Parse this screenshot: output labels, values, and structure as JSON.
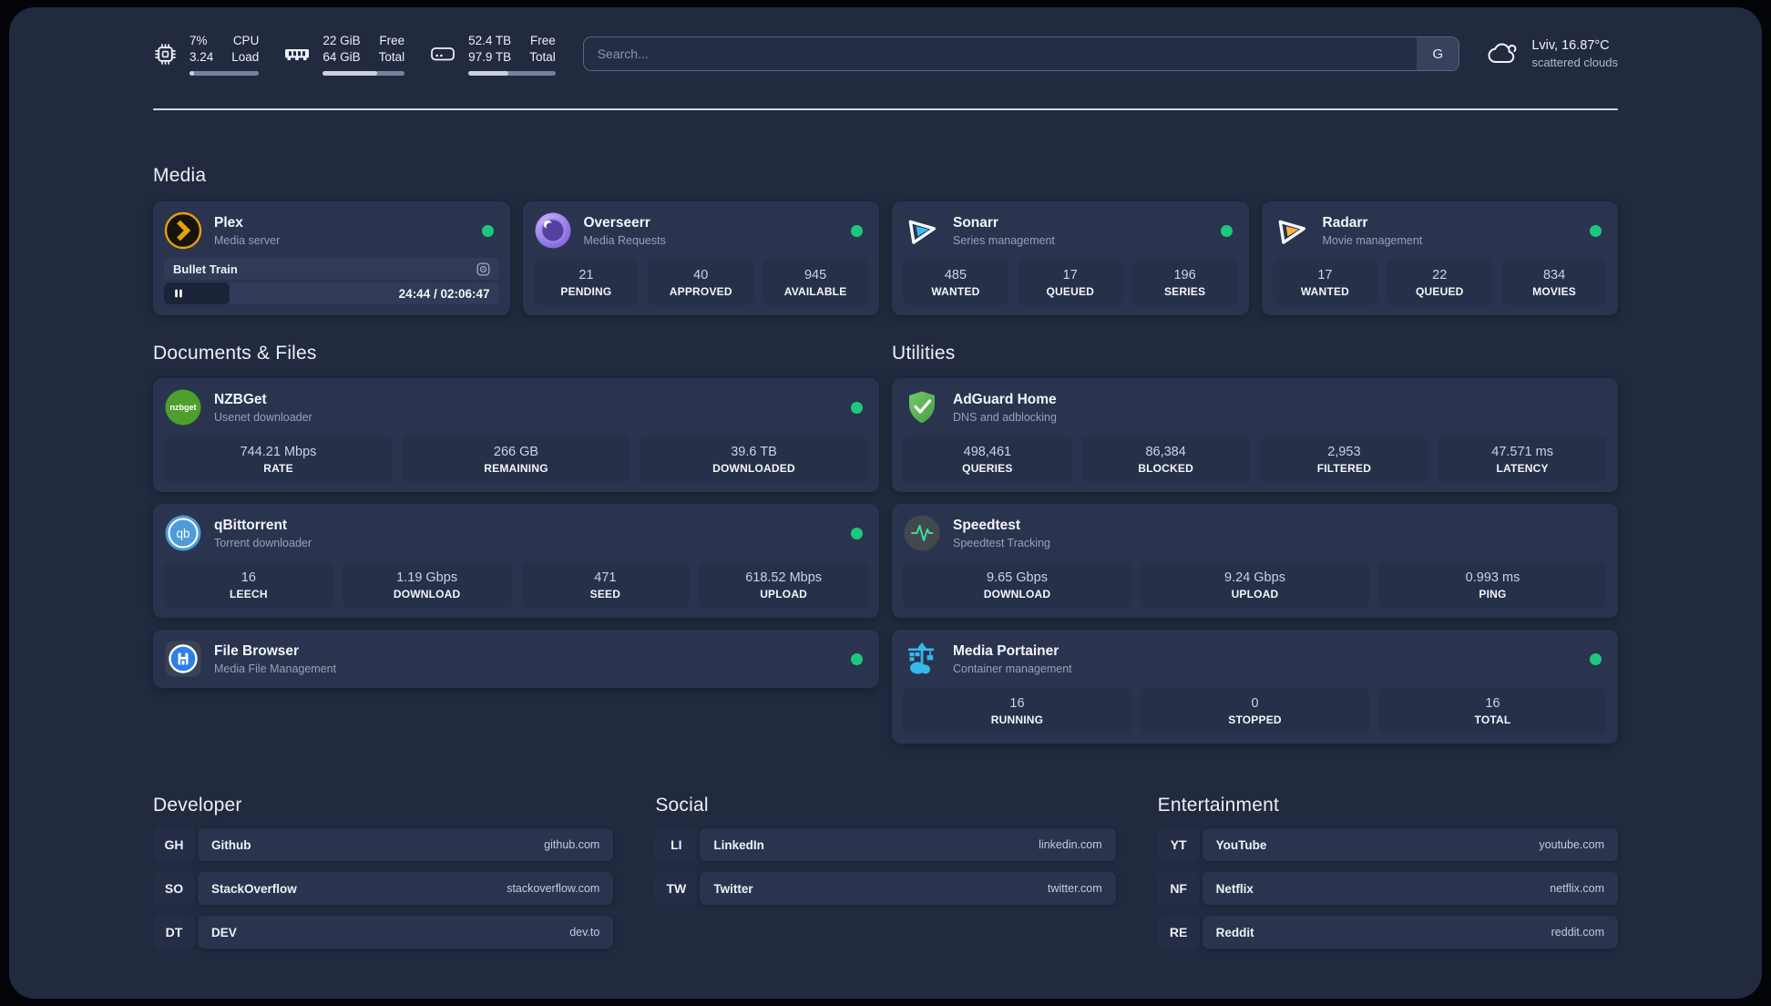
{
  "topbar": {
    "cpu": {
      "value_top": "7%",
      "value_bottom": "3.24",
      "label_top": "CPU",
      "label_bottom": "Load",
      "progress_pct": 7
    },
    "memory": {
      "value_top": "22 GiB",
      "value_bottom": "64 GiB",
      "label_top": "Free",
      "label_bottom": "Total",
      "progress_pct": 66
    },
    "storage": {
      "value_top": "52.4 TB",
      "value_bottom": "97.9 TB",
      "label_top": "Free",
      "label_bottom": "Total",
      "progress_pct": 46
    },
    "search": {
      "placeholder": "Search...",
      "button": "G"
    },
    "weather": {
      "location": "Lviv, 16.87°C",
      "condition": "scattered clouds"
    }
  },
  "sections": {
    "media": "Media",
    "documents": "Documents & Files",
    "utilities": "Utilities"
  },
  "apps": {
    "plex": {
      "name": "Plex",
      "subtitle": "Media server",
      "status": "online",
      "now_playing": {
        "title": "Bullet Train",
        "time": "24:44 / 02:06:47",
        "progress_pct": 19.5
      }
    },
    "overseerr": {
      "name": "Overseerr",
      "subtitle": "Media Requests",
      "status": "online",
      "stats": [
        {
          "value": "21",
          "label": "PENDING"
        },
        {
          "value": "40",
          "label": "APPROVED"
        },
        {
          "value": "945",
          "label": "AVAILABLE"
        }
      ]
    },
    "sonarr": {
      "name": "Sonarr",
      "subtitle": "Series management",
      "status": "online",
      "stats": [
        {
          "value": "485",
          "label": "WANTED"
        },
        {
          "value": "17",
          "label": "QUEUED"
        },
        {
          "value": "196",
          "label": "SERIES"
        }
      ]
    },
    "radarr": {
      "name": "Radarr",
      "subtitle": "Movie management",
      "status": "online",
      "stats": [
        {
          "value": "17",
          "label": "WANTED"
        },
        {
          "value": "22",
          "label": "QUEUED"
        },
        {
          "value": "834",
          "label": "MOVIES"
        }
      ]
    },
    "nzbget": {
      "name": "NZBGet",
      "subtitle": "Usenet downloader",
      "status": "online",
      "stats": [
        {
          "value": "744.21 Mbps",
          "label": "RATE"
        },
        {
          "value": "266 GB",
          "label": "REMAINING"
        },
        {
          "value": "39.6 TB",
          "label": "DOWNLOADED"
        }
      ]
    },
    "qbittorrent": {
      "name": "qBittorrent",
      "subtitle": "Torrent downloader",
      "status": "online",
      "stats": [
        {
          "value": "16",
          "label": "LEECH"
        },
        {
          "value": "1.19 Gbps",
          "label": "DOWNLOAD"
        },
        {
          "value": "471",
          "label": "SEED"
        },
        {
          "value": "618.52 Mbps",
          "label": "UPLOAD"
        }
      ]
    },
    "filebrowser": {
      "name": "File Browser",
      "subtitle": "Media File Management",
      "status": "online"
    },
    "adguard": {
      "name": "AdGuard Home",
      "subtitle": "DNS and adblocking",
      "stats": [
        {
          "value": "498,461",
          "label": "QUERIES"
        },
        {
          "value": "86,384",
          "label": "BLOCKED"
        },
        {
          "value": "2,953",
          "label": "FILTERED"
        },
        {
          "value": "47.571 ms",
          "label": "LATENCY"
        }
      ]
    },
    "speedtest": {
      "name": "Speedtest",
      "subtitle": "Speedtest Tracking",
      "stats": [
        {
          "value": "9.65 Gbps",
          "label": "DOWNLOAD"
        },
        {
          "value": "9.24 Gbps",
          "label": "UPLOAD"
        },
        {
          "value": "0.993 ms",
          "label": "PING"
        }
      ]
    },
    "portainer": {
      "name": "Media Portainer",
      "subtitle": "Container management",
      "status": "online",
      "stats": [
        {
          "value": "16",
          "label": "RUNNING"
        },
        {
          "value": "0",
          "label": "STOPPED"
        },
        {
          "value": "16",
          "label": "TOTAL"
        }
      ]
    }
  },
  "links": {
    "developer": {
      "title": "Developer",
      "items": [
        {
          "badge": "GH",
          "name": "Github",
          "url": "github.com"
        },
        {
          "badge": "SO",
          "name": "StackOverflow",
          "url": "stackoverflow.com"
        },
        {
          "badge": "DT",
          "name": "DEV",
          "url": "dev.to"
        }
      ]
    },
    "social": {
      "title": "Social",
      "items": [
        {
          "badge": "LI",
          "name": "LinkedIn",
          "url": "linkedin.com"
        },
        {
          "badge": "TW",
          "name": "Twitter",
          "url": "twitter.com"
        }
      ]
    },
    "entertainment": {
      "title": "Entertainment",
      "items": [
        {
          "badge": "YT",
          "name": "YouTube",
          "url": "youtube.com"
        },
        {
          "badge": "NF",
          "name": "Netflix",
          "url": "netflix.com"
        },
        {
          "badge": "RE",
          "name": "Reddit",
          "url": "reddit.com"
        }
      ]
    }
  },
  "colors": {
    "status_online": "#1EC77F",
    "plex": "#E5A00D",
    "sonarr": "#38BDF8",
    "radarr": "#FFB53C",
    "nzbget": "#4E9F2E",
    "qbittorrent": "#4E9BD8",
    "adguard": "#5BBE58",
    "speedtest_pulse": "#3DDC97",
    "portainer": "#35B8EB",
    "filebrowser": "#2E7FE8"
  }
}
